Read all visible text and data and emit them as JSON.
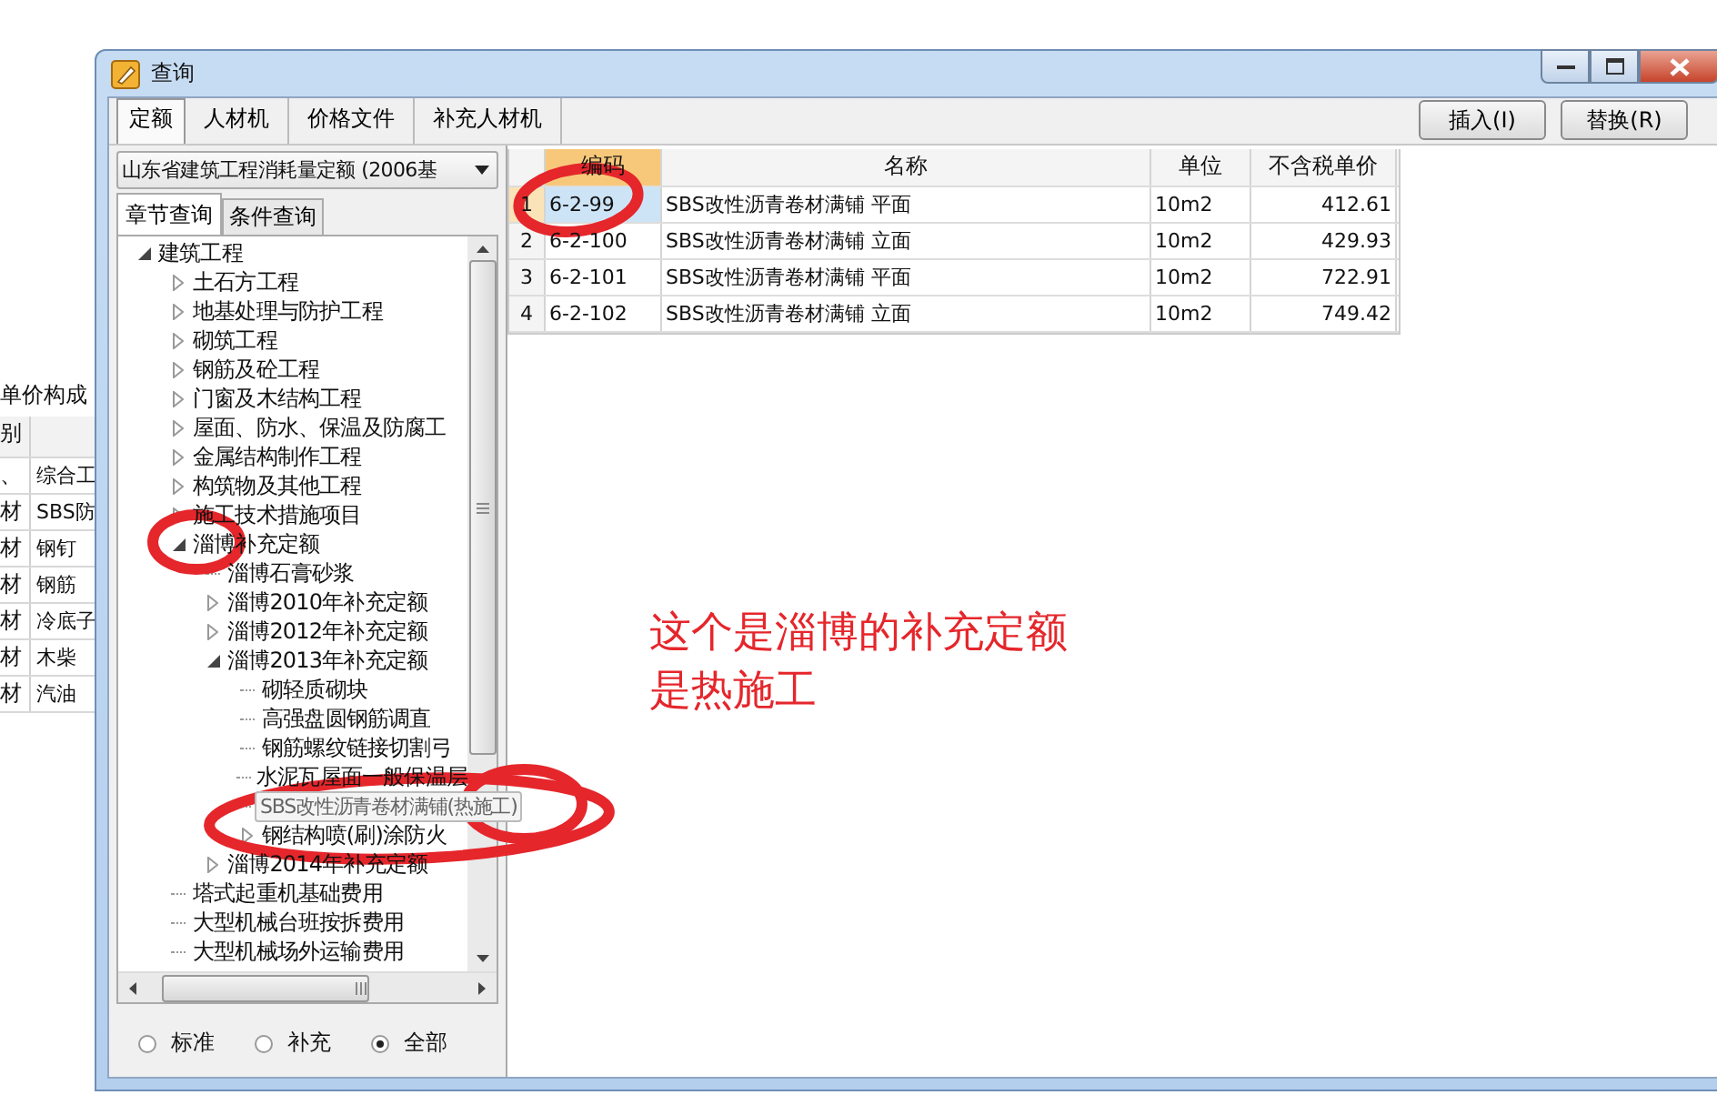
{
  "background_window": {
    "heading": "单价构成",
    "column_1_header": "别",
    "rows": [
      {
        "column_1": "、",
        "column_2": "综合工"
      },
      {
        "column_1": "材",
        "column_2": "SBS防"
      },
      {
        "column_1": "材",
        "column_2": "钢钉"
      },
      {
        "column_1": "材",
        "column_2": "钢筋"
      },
      {
        "column_1": "材",
        "column_2": "冷底子"
      },
      {
        "column_1": "材",
        "column_2": "木柴"
      },
      {
        "column_1": "材",
        "column_2": "汽油"
      }
    ]
  },
  "window": {
    "title": "查询"
  },
  "tabs": [
    {
      "label": "定额",
      "selected": true
    },
    {
      "label": "人材机",
      "selected": false
    },
    {
      "label": "价格文件",
      "selected": false
    },
    {
      "label": "补充人材机",
      "selected": false
    }
  ],
  "buttons": [
    "插入(I)",
    "替换(R)"
  ],
  "library_select": {
    "value": "山东省建筑工程消耗量定额 (2006基"
  },
  "search_tabs": [
    {
      "label": "章节查询",
      "selected": true
    },
    {
      "label": "条件查询",
      "selected": false
    }
  ],
  "tree": [
    {
      "label": "建筑工程",
      "expanded": true,
      "selected": false,
      "children": [
        {
          "label": "土石方工程",
          "expanded": false,
          "selected": false
        },
        {
          "label": "地基处理与防护工程",
          "expanded": false,
          "selected": false
        },
        {
          "label": "砌筑工程",
          "expanded": false,
          "selected": false
        },
        {
          "label": "钢筋及砼工程",
          "expanded": false,
          "selected": false
        },
        {
          "label": "门窗及木结构工程",
          "expanded": false,
          "selected": false
        },
        {
          "label": "屋面、防水、保温及防腐工",
          "expanded": false,
          "selected": false
        },
        {
          "label": "金属结构制作工程",
          "expanded": false,
          "selected": false
        },
        {
          "label": "构筑物及其他工程",
          "expanded": false,
          "selected": false
        },
        {
          "label": "施工技术措施项目",
          "expanded": false,
          "selected": false
        },
        {
          "label": "淄博补充定额",
          "expanded": true,
          "selected": false,
          "children": [
            {
              "label": "淄博石膏砂浆",
              "selected": false
            },
            {
              "label": "淄博2010年补充定额",
              "expanded": false,
              "selected": false
            },
            {
              "label": "淄博2012年补充定额",
              "expanded": false,
              "selected": false
            },
            {
              "label": "淄博2013年补充定额",
              "expanded": true,
              "selected": false,
              "children": [
                {
                  "label": "砌轻质砌块",
                  "selected": false
                },
                {
                  "label": "高强盘圆钢筋调直",
                  "selected": false
                },
                {
                  "label": "钢筋螺纹链接切割弓",
                  "selected": false
                },
                {
                  "label": "水泥瓦屋面一般保温层",
                  "selected": false
                },
                {
                  "label": "SBS改性沥青卷材满铺(热施工)",
                  "selected": true
                },
                {
                  "label": "钢结构喷(刷)涂防火",
                  "expanded": false,
                  "selected": false
                }
              ]
            },
            {
              "label": "淄博2014年补充定额",
              "expanded": false,
              "selected": false
            }
          ]
        },
        {
          "label": "塔式起重机基础费用",
          "selected": false
        },
        {
          "label": "大型机械台班按拆费用",
          "selected": false
        },
        {
          "label": "大型机械场外运输费用",
          "selected": false
        }
      ]
    }
  ],
  "filters": [
    {
      "label": "标准",
      "selected": false
    },
    {
      "label": "补充",
      "selected": false
    },
    {
      "label": "全部",
      "selected": true
    }
  ],
  "table": {
    "columns": [
      {
        "label": "编码",
        "selected": true
      },
      {
        "label": "名称",
        "selected": false
      },
      {
        "label": "单位",
        "selected": false
      },
      {
        "label": "不含税单价",
        "selected": false
      }
    ],
    "rows": [
      {
        "number": "1",
        "code": "6-2-99",
        "name": "SBS改性沥青卷材满铺 平面",
        "unit": "10m2",
        "price": "412.61",
        "selected": true
      },
      {
        "number": "2",
        "code": "6-2-100",
        "name": "SBS改性沥青卷材满铺 立面",
        "unit": "10m2",
        "price": "429.93",
        "selected": false
      },
      {
        "number": "3",
        "code": "6-2-101",
        "name": "SBS改性沥青卷材满铺 平面",
        "unit": "10m2",
        "price": "722.91",
        "selected": false
      },
      {
        "number": "4",
        "code": "6-2-102",
        "name": "SBS改性沥青卷材满铺 立面",
        "unit": "10m2",
        "price": "749.42",
        "selected": false
      }
    ]
  },
  "annotation": {
    "lines": [
      "这个是淄博的补充定额",
      "是热施工"
    ]
  }
}
